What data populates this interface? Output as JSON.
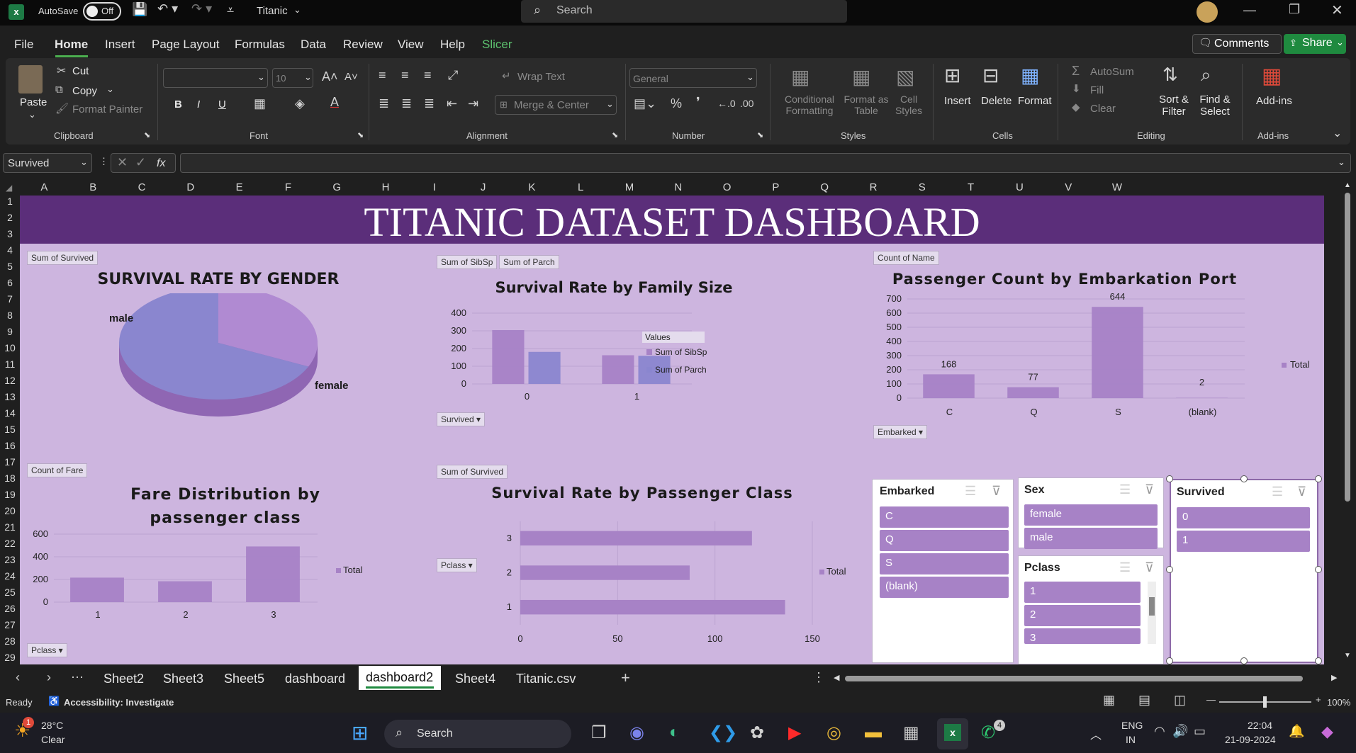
{
  "titlebar": {
    "autosave": "AutoSave",
    "toggle": "Off",
    "filename": "Titanic",
    "search": "Search"
  },
  "menu": [
    "File",
    "Home",
    "Insert",
    "Page Layout",
    "Formulas",
    "Data",
    "Review",
    "View",
    "Help",
    "Slicer"
  ],
  "menu_right": {
    "comments": "Comments",
    "share": "Share"
  },
  "ribbon": {
    "clipboard": {
      "paste": "Paste",
      "cut": "Cut",
      "copy": "Copy",
      "format_painter": "Format Painter",
      "group": "Clipboard"
    },
    "font": {
      "size": "10",
      "group": "Font",
      "bold": "B",
      "italic": "I",
      "underline": "U"
    },
    "alignment": {
      "wrap": "Wrap Text",
      "merge": "Merge & Center",
      "group": "Alignment"
    },
    "number": {
      "format": "General",
      "group": "Number"
    },
    "styles": {
      "cond": "Conditional Formatting",
      "fmt_table": "Format as Table",
      "cell_styles": "Cell Styles",
      "group": "Styles"
    },
    "cells": {
      "insert": "Insert",
      "delete": "Delete",
      "format": "Format",
      "group": "Cells"
    },
    "editing": {
      "autosum": "AutoSum",
      "fill": "Fill",
      "clear": "Clear",
      "sort": "Sort & Filter",
      "find": "Find & Select",
      "group": "Editing"
    },
    "addins": {
      "label": "Add-ins",
      "group": "Add-ins"
    }
  },
  "formula_bar": {
    "name_box": "Survived",
    "fx": "fx",
    "value": ""
  },
  "columns": [
    "A",
    "B",
    "C",
    "D",
    "E",
    "F",
    "G",
    "H",
    "I",
    "J",
    "K",
    "L",
    "M",
    "N",
    "O",
    "P",
    "Q",
    "R",
    "S",
    "T",
    "U",
    "V",
    "W"
  ],
  "rows": [
    "1",
    "2",
    "3",
    "4",
    "5",
    "6",
    "7",
    "8",
    "9",
    "10",
    "11",
    "12",
    "13",
    "14",
    "15",
    "16",
    "17",
    "18",
    "19",
    "20",
    "21",
    "22",
    "23",
    "24",
    "25",
    "26",
    "27",
    "28",
    "29"
  ],
  "dashboard": {
    "title": "TITANIC DATASET DASHBOARD"
  },
  "chart_data": [
    {
      "type": "pie",
      "title": "SURVIVAL RATE BY GENDER",
      "field_button": "Sum of Survived",
      "categories": [
        "male",
        "female"
      ],
      "values": [
        109,
        233
      ]
    },
    {
      "type": "bar",
      "title": "Survival Rate by Family Size",
      "field_buttons": [
        "Sum of SibSp",
        "Sum of Parch"
      ],
      "axis_button": "Survived",
      "legend_title": "Values",
      "categories": [
        "0",
        "1"
      ],
      "series": [
        {
          "name": "Sum of SibSp",
          "values": [
            304,
            162
          ]
        },
        {
          "name": "Sum of Parch",
          "values": [
            181,
            159
          ]
        }
      ],
      "ylim": [
        0,
        400
      ],
      "yticks": [
        "0",
        "100",
        "200",
        "300",
        "400"
      ]
    },
    {
      "type": "bar",
      "title": "Passenger Count by Embarkation Port",
      "field_button": "Count of Name",
      "axis_button": "Embarked",
      "legend": "Total",
      "categories": [
        "C",
        "Q",
        "S",
        "(blank)"
      ],
      "values": [
        168,
        77,
        644,
        2
      ],
      "data_labels": [
        "168",
        "77",
        "644",
        "2"
      ],
      "ylim": [
        0,
        700
      ],
      "yticks": [
        "0",
        "100",
        "200",
        "300",
        "400",
        "500",
        "600",
        "700"
      ]
    },
    {
      "type": "bar",
      "title": "Fare Distribution by passenger class",
      "field_button": "Count of Fare",
      "axis_button": "Pclass",
      "legend": "Total",
      "categories": [
        "1",
        "2",
        "3"
      ],
      "values": [
        216,
        184,
        491
      ],
      "ylim": [
        0,
        600
      ],
      "yticks": [
        "0",
        "200",
        "400",
        "600"
      ]
    },
    {
      "type": "bar",
      "orientation": "horizontal",
      "title": "Survival Rate by Passenger Class",
      "field_button": "Sum of Survived",
      "axis_button": "Pclass",
      "legend": "Total",
      "categories": [
        "1",
        "2",
        "3"
      ],
      "values": [
        136,
        87,
        119
      ],
      "xlim": [
        0,
        150
      ],
      "xticks": [
        "0",
        "50",
        "100",
        "150"
      ]
    }
  ],
  "slicers": {
    "embarked": {
      "title": "Embarked",
      "items": [
        "C",
        "Q",
        "S",
        "(blank)"
      ]
    },
    "sex": {
      "title": "Sex",
      "items": [
        "female",
        "male"
      ]
    },
    "pclass": {
      "title": "Pclass",
      "items": [
        "1",
        "2",
        "3"
      ]
    },
    "survived": {
      "title": "Survived",
      "items": [
        "0",
        "1"
      ]
    }
  },
  "sheet_tabs": [
    "Sheet2",
    "Sheet3",
    "Sheet5",
    "dashboard",
    "dashboard2",
    "Sheet4",
    "Titanic.csv"
  ],
  "active_tab": "dashboard2",
  "status": {
    "ready": "Ready",
    "accessibility": "Accessibility: Investigate",
    "zoom": "100%"
  },
  "taskbar": {
    "temp": "28°C",
    "weather": "Clear",
    "search": "Search",
    "lang1": "ENG",
    "lang2": "IN",
    "time": "22:04",
    "date": "21-09-2024",
    "badge1": "1",
    "badge2": "4"
  },
  "colors": {
    "purple_dark": "#5b2e7a",
    "sheet_bg": "#cdb5df",
    "bar": "#a782c6",
    "bar2": "#8a86cf"
  }
}
